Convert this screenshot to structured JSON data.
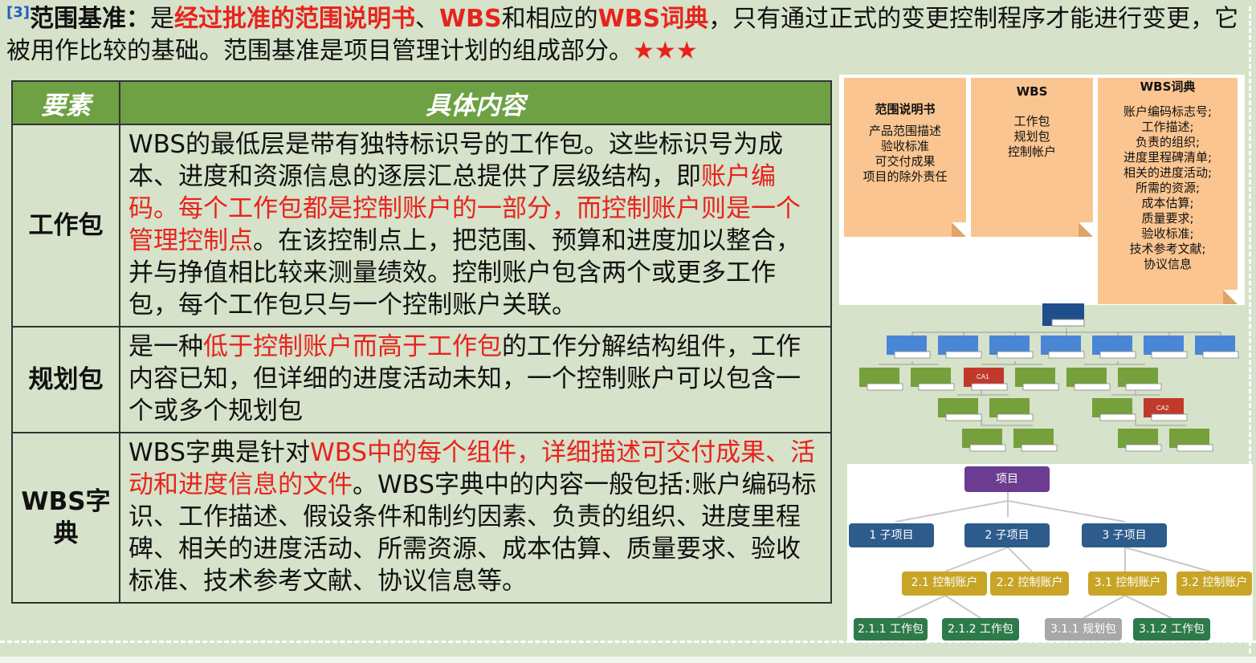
{
  "heading": {
    "ref": "[3]",
    "term": "范围基准：",
    "p1": "是",
    "p2": "经过批准的范围说明书",
    "p3": "、",
    "p4": "WBS",
    "p5": "和相应的",
    "p6": "WBS词典",
    "p7": "，只有通过正式的变更控制程序才能进行变更，它被用作比较的基础。范围基准是项目管理计划的组成部分。",
    "stars": "★★★"
  },
  "table": {
    "col1": "要素",
    "col2": "具体内容",
    "rows": [
      {
        "key": "工作包",
        "s1": "WBS的最低层是带有独特标识号的工作包。这些标识号为成本、进度和资源信息的逐层汇总提供了层级结构，即",
        "s2": "账户编码。每个工作包都是控制账户的一部分，而控制账户则是一个管理控制点",
        "s3": "。在该控制点上，把范围、预算和进度加以整合，并与挣值相比较来测量绩效。控制账户包含两个或更多工作包，每个工作包只与一个控制账户关联。"
      },
      {
        "key": "规划包",
        "s1": "是一种",
        "s2": "低于控制账户而高于工作包",
        "s3": "的工作分解结构组件，工作内容已知，但详细的进度活动未知，一个控制账户可以包含一个或多个规划包"
      },
      {
        "key": "WBS字典",
        "s1": "WBS字典是针对",
        "s2": "WBS中的每个组件，详细描述可交付成果、活动和进度信息的文件",
        "s3": "。WBS字典中的内容一般包括:账户编码标识、工作描述、假设条件和制约因素、负责的组织、进度里程碑、相关的进度活动、所需资源、成本估算、质量要求、验收标准、技术参考文献、协议信息等。"
      }
    ]
  },
  "cards": [
    {
      "title": "范围说明书",
      "items": [
        "产品范围描述",
        "验收标准",
        "可交付成果",
        "项目的除外责任"
      ]
    },
    {
      "title": "WBS",
      "items": [
        "工作包",
        "规划包",
        "控制帐户"
      ]
    },
    {
      "title": "WBS词典",
      "items": [
        "账户编码标志号;",
        "工作描述;",
        "负责的组织;",
        "进度里程碑清单;",
        "相关的进度活动;",
        "所需的资源;",
        "成本估算;",
        "质量要求;",
        "验收标准;",
        "技术参考文献;",
        "协议信息"
      ]
    }
  ],
  "tree": {
    "ca1": "CA1",
    "ca2": "CA2"
  },
  "org": {
    "root": "项目",
    "subs": [
      "1 子项目",
      "2 子项目",
      "3 子项目"
    ],
    "cas": [
      "2.1 控制账户",
      "2.2 控制账户",
      "3.1 控制账户",
      "3.2 控制账户"
    ],
    "leaves": [
      "2.1.1 工作包",
      "2.1.2 工作包",
      "3.1.1 规划包",
      "3.1.2 工作包"
    ],
    "colors": {
      "root": "#6b3c91",
      "sub": "#2d5b8c",
      "ca": "#c8a526",
      "wp": "#2f7a4a",
      "plan": "#a8a8a8"
    }
  }
}
